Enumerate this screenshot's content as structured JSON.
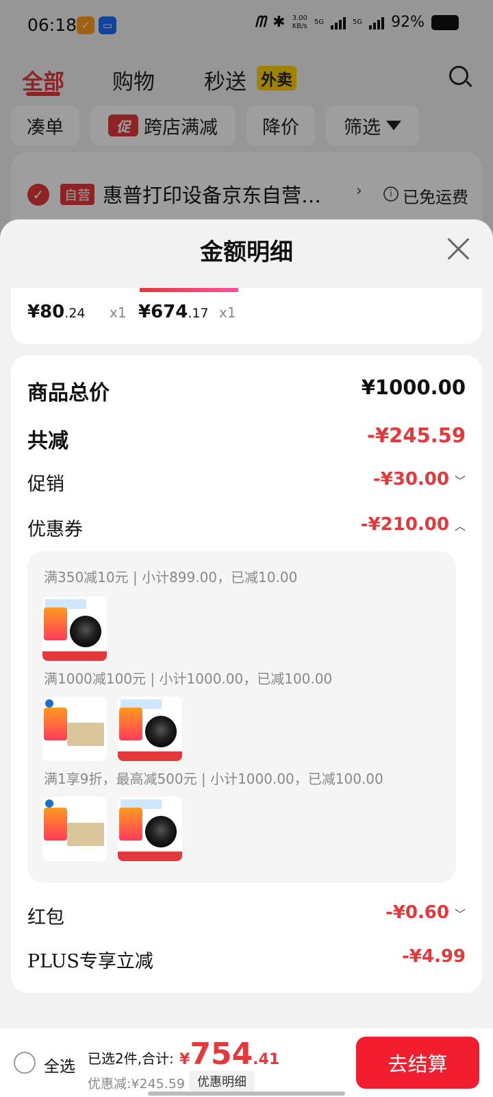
{
  "status_bar": {
    "time": "06:18",
    "net_speed_top": "3.00",
    "net_speed_bottom": "KB/s",
    "sim1": "5G",
    "sim2": "5G",
    "battery": "92%"
  },
  "tabs": [
    {
      "label": "全部"
    },
    {
      "label": "购物"
    },
    {
      "label": "秒送"
    }
  ],
  "waimai_badge": "外卖",
  "filters": {
    "coudan": "凑单",
    "cu_badge": "促",
    "kuadian": "跨店满减",
    "jiangjia": "降价",
    "shaixuan": "筛选"
  },
  "shop": {
    "badge": "自营",
    "name": "惠普打印设备京东自营…",
    "arrow": "›",
    "shipping": "已免运费"
  },
  "sheet": {
    "title": "金额明细"
  },
  "items": [
    {
      "price_int": "¥80",
      "price_dec": ".24",
      "qty": "x1"
    },
    {
      "price_int": "¥674",
      "price_dec": ".17",
      "qty": "x1"
    }
  ],
  "details": {
    "total_label": "商品总价",
    "total_value": "¥1000.00",
    "reduce_label": "共减",
    "reduce_value": "-¥245.59",
    "promo_label": "促销",
    "promo_value": "-¥30.00",
    "coupon_label": "优惠券",
    "coupon_value": "-¥210.00",
    "coupons": [
      {
        "text": "满350减10元 | 小计899.00，已减10.00"
      },
      {
        "text": "满1000减100元 | 小计1000.00，已减100.00"
      },
      {
        "text": "满1享9折，最高减500元 | 小计1000.00，已减100.00"
      }
    ],
    "hongbao_label": "红包",
    "hongbao_value": "-¥0.60",
    "plus_label": "PLUS专享立减",
    "plus_value": "-¥4.99"
  },
  "bottom": {
    "select_all": "全选",
    "selected": "已选2件,合计:",
    "total_yen": "¥",
    "total_int": "754",
    "total_dec": ".41",
    "discount": "优惠减:¥245.59",
    "detail_link": "优惠明细",
    "checkout": "去结算"
  },
  "colors": {
    "accent": "#e4393c",
    "checkout": "#f21e2f",
    "badge_yellow": "#ffd400"
  }
}
